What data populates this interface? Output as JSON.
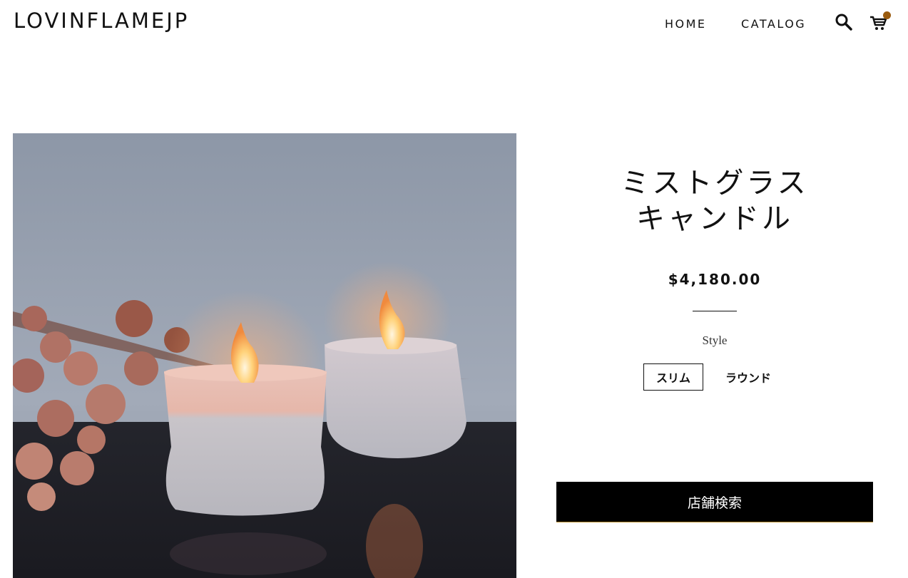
{
  "header": {
    "logo": "LOVINFLAMEJP",
    "nav": [
      {
        "label": "HOME"
      },
      {
        "label": "CATALOG"
      }
    ],
    "icons": {
      "search": "search-icon",
      "cart": "cart-icon"
    },
    "cart_indicator_color": "#9a5b0f"
  },
  "product": {
    "title_line1": "ミストグラス",
    "title_line2": "キャンドル",
    "price": "$4,180.00",
    "style_label": "Style",
    "variants": [
      {
        "label": "スリム",
        "selected": true
      },
      {
        "label": "ラウンド",
        "selected": false
      }
    ],
    "store_button": "店舗検索"
  },
  "colors": {
    "accent": "#000000",
    "button_underline": "#b58a2a"
  }
}
